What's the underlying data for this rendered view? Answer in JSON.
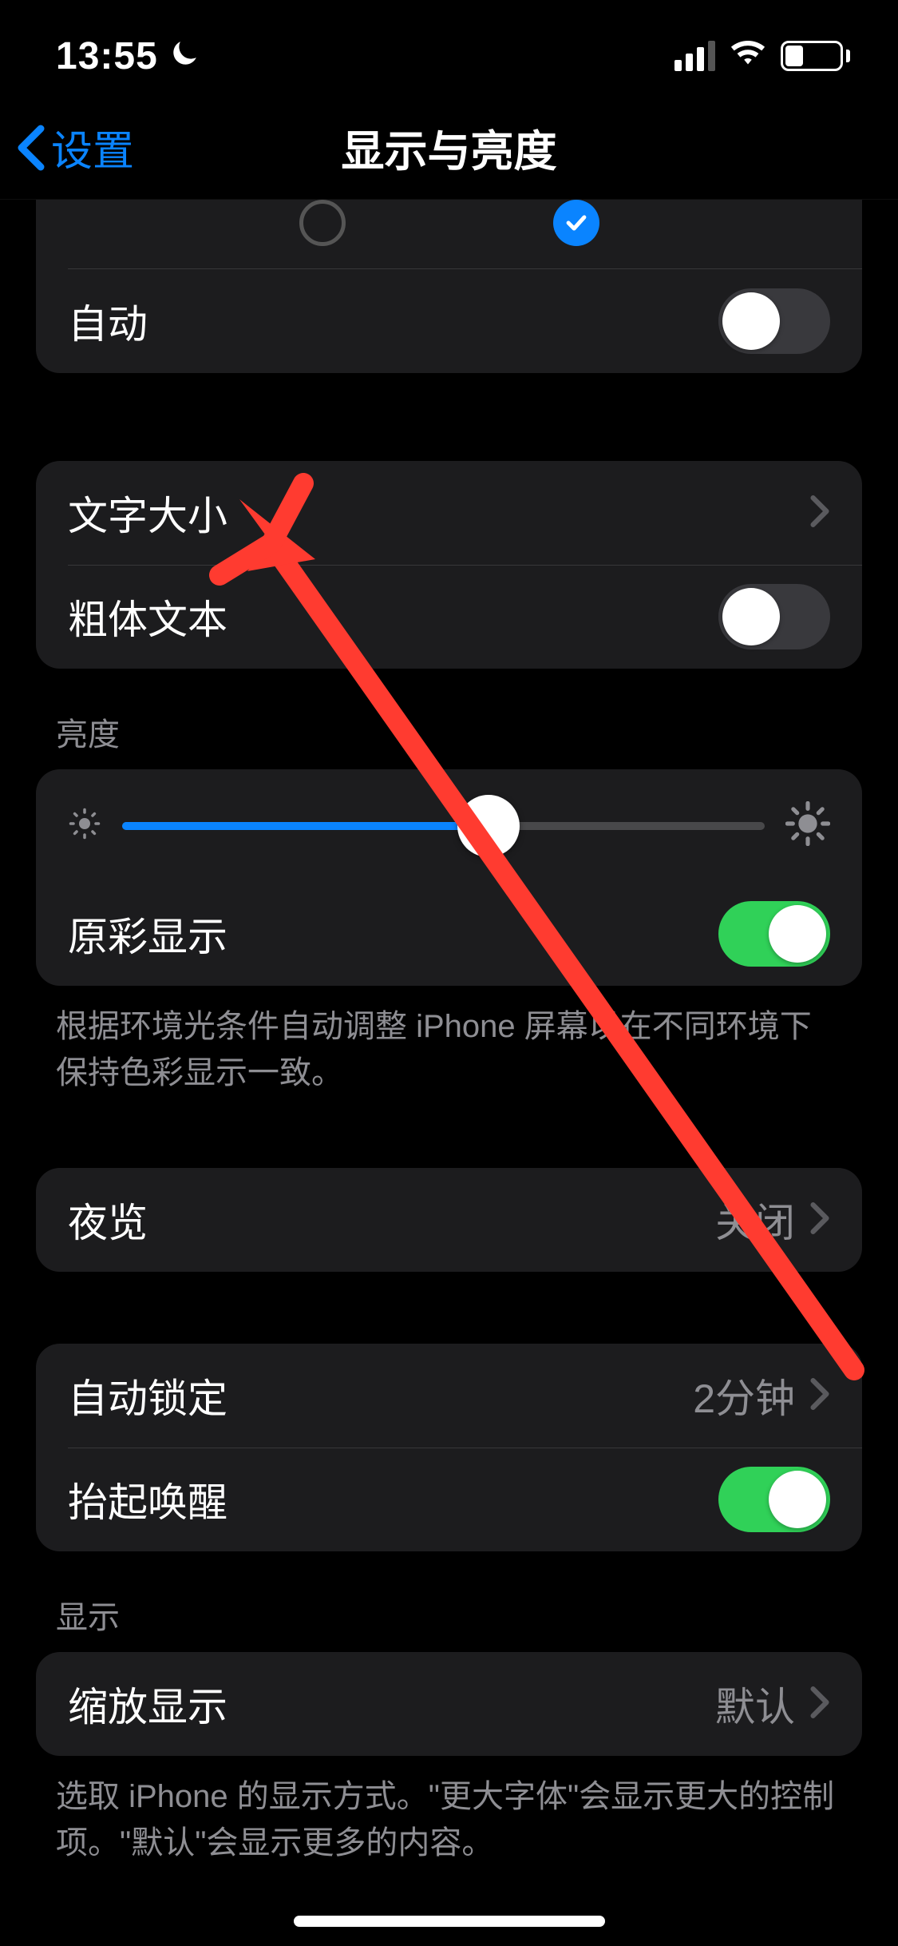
{
  "statusBar": {
    "time": "13:55",
    "batteryPercent": "27"
  },
  "nav": {
    "back": "设置",
    "title": "显示与亮度"
  },
  "appearance": {
    "autoLabel": "自动",
    "autoOn": false
  },
  "text": {
    "textSize": "文字大小",
    "boldText": "粗体文本",
    "boldOn": false
  },
  "brightness": {
    "header": "亮度",
    "valuePercent": 57,
    "trueTone": "原彩显示",
    "trueToneOn": true,
    "footer": "根据环境光条件自动调整 iPhone 屏幕以在不同环境下保持色彩显示一致。"
  },
  "nightShift": {
    "label": "夜览",
    "value": "关闭"
  },
  "autoLock": {
    "label": "自动锁定",
    "value": "2分钟",
    "raiseToWake": "抬起唤醒",
    "raiseOn": true
  },
  "display": {
    "header": "显示",
    "zoomLabel": "缩放显示",
    "zoomValue": "默认",
    "footer": "选取 iPhone 的显示方式。\"更大字体\"会显示更大的控制项。\"默认\"会显示更多的内容。"
  },
  "colors": {
    "accent": "#0a84ff",
    "green": "#30d158",
    "annotation": "#ff3b30"
  }
}
